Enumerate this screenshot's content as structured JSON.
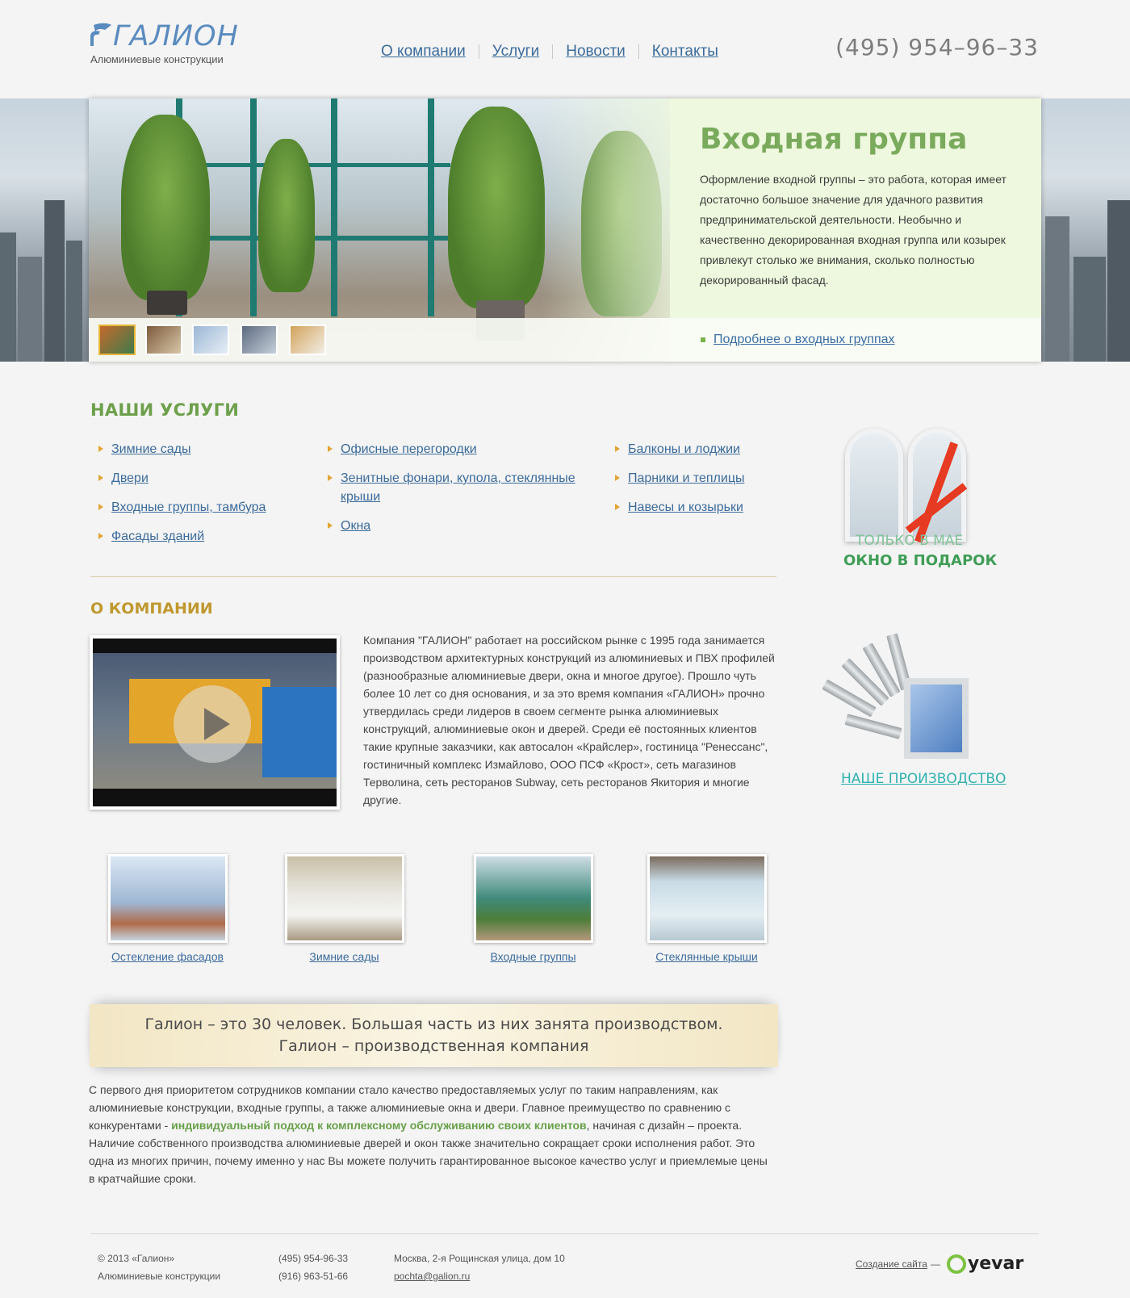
{
  "header": {
    "logo_text": "ГАЛИОН",
    "logo_sub": "Алюминиевые конструкции",
    "nav": [
      "О компании",
      "Услуги",
      "Новости",
      "Контакты"
    ],
    "phone": "(495) 954–96–33"
  },
  "banner": {
    "title": "Входная группа",
    "text": "Оформление входной группы – это работа, которая имеет достаточно большое значение для удачного развития предпринимательской деятельности. Необычно и качественно декорированная входная группа или козырек привлекут столько же внимания, сколько полностью декорированный фасад.",
    "more_link": "Подробнее о входных группах",
    "thumbnails_count": 5,
    "active_thumbnail": 1
  },
  "services": {
    "title": "НАШИ УСЛУГИ",
    "col1": [
      "Зимние сады",
      "Двери",
      "Входные группы, тамбура",
      "Фасады зданий"
    ],
    "col2": [
      "Офисные перегородки",
      "Зенитные фонари, купола, стеклянные крыши",
      "Окна"
    ],
    "col3": [
      "Балконы и лоджии",
      "Парники и теплицы",
      "Навесы и козырьки"
    ]
  },
  "about": {
    "title": "О КОМПАНИИ",
    "text": "Компания \"ГАЛИОН\" работает на российском рынке с 1995 года занимается производством архитектурных конструкций из алюминиевых и ПВХ профилей (разнообразные алюминиевые двери, окна и многое другое). Прошло чуть более 10 лет со дня основания, и за это время компания «ГАЛИОН» прочно утвердилась среди лидеров в своем сегменте рынка алюминиевых конструкций, алюминиевые окон и дверей. Среди её постоянных клиентов такие крупные заказчики, как автосалон «Крайслер», гостиница \"Ренессанс\", гостиничный комплекс Измайлово, ООО ПСФ «Крост», сеть магазинов Терволина, сеть ресторанов Subway, сеть ресторанов Якитория и многие другие."
  },
  "sidebar": {
    "promo_line1": "ТОЛЬКО В МАЕ",
    "promo_line2": "ОКНО В ПОДАРОК",
    "production": "НАШЕ ПРОИЗВОДСТВО"
  },
  "gallery": [
    "Остекление фасадов",
    "Зимние сады",
    "Входные группы",
    "Стеклянные крыши"
  ],
  "quote": {
    "line1": "Галион – это 30 человек. Большая часть из них занята производством.",
    "line2": "Галион – производственная компания"
  },
  "bottom": {
    "text_before": "С первого дня приоритетом сотрудников компании стало качество предоставляемых услуг по таким направлениям, как алюминиевые конструкции, входные группы, а также алюминиевые окна и двери. Главное преимущество по сравнению с конкурентами - ",
    "highlight": "индивидуальный подход к комплексному обслуживанию своих клиентов",
    "text_after": ", начиная с дизайн – проекта. Наличие собственного производства алюминиевые дверей и окон также значительно сокращает сроки исполнения работ. Это одна из многих причин, почему именно у нас Вы можете получить гарантированное высокое качество услуг и приемлемые цены в кратчайшие сроки."
  },
  "footer": {
    "copyright": "© 2013  «Галион»",
    "company": "Алюминиевые конструкции",
    "phone1": "(495) 954-96-33",
    "phone2": "(916) 963-51-66",
    "address": "Москва, 2-я Рощинская улица, дом 10",
    "email": "pochta@galion.ru",
    "credit_link": "Создание сайта",
    "credit_dash": "—",
    "credit_brand": "yevar"
  },
  "colors": {
    "link": "#3b6b9b",
    "green_heading": "#6ea04c",
    "gold_heading": "#c0982e",
    "banner_bg": "#eef8de",
    "promo_green": "#3f9d56",
    "production_teal": "#2fb1b0"
  }
}
